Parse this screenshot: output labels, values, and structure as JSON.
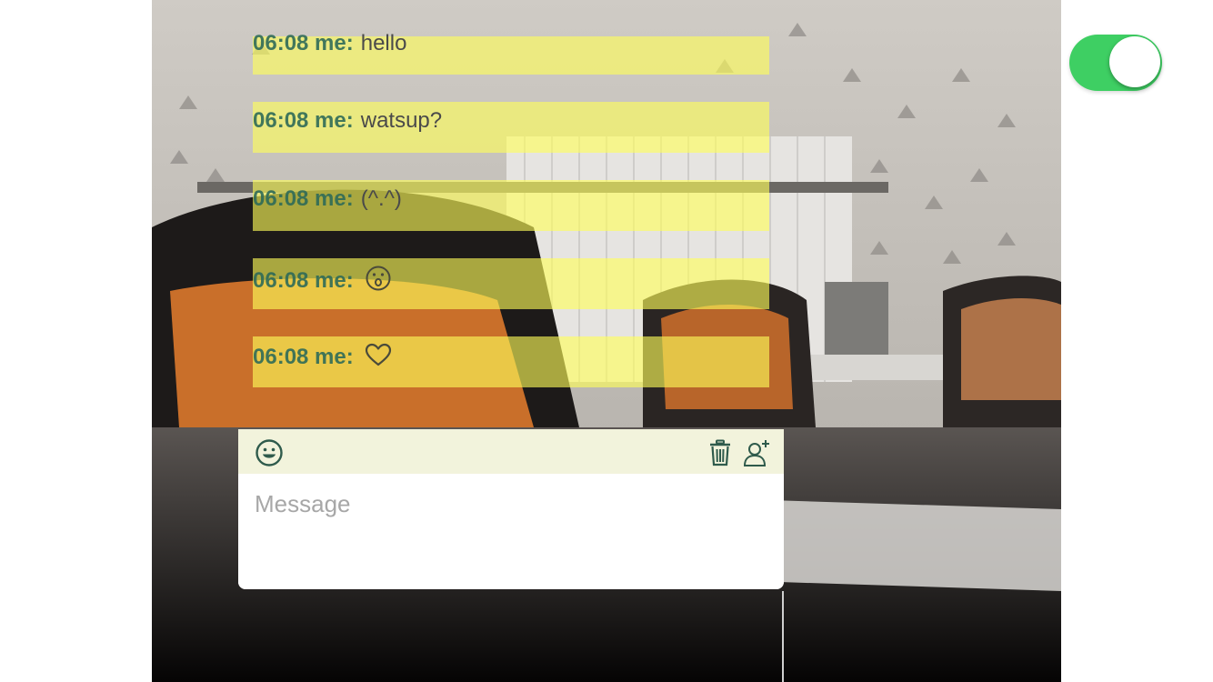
{
  "chat": {
    "messages": [
      {
        "time": "06:08 me:",
        "text": "hello",
        "icon": null
      },
      {
        "time": "06:08 me:",
        "text": "watsup?",
        "icon": null
      },
      {
        "time": "06:08 me:",
        "text": "(^.^)",
        "icon": null
      },
      {
        "time": "06:08 me:",
        "text": "",
        "icon": "surprised-face-icon"
      },
      {
        "time": "06:08 me:",
        "text": "",
        "icon": "heart-icon"
      }
    ]
  },
  "composer": {
    "placeholder": "Message",
    "value": "",
    "icons": {
      "emoji": "smiley-face-icon",
      "delete": "trash-icon",
      "add_user": "add-user-icon"
    }
  },
  "toggle": {
    "on": true,
    "color": "#3ecf63"
  },
  "colors": {
    "message_highlight": "#ffff58",
    "time_text": "#2f6b58",
    "toolbar_bg": "#f2f3dc",
    "icon_color": "#2f5b4c"
  }
}
